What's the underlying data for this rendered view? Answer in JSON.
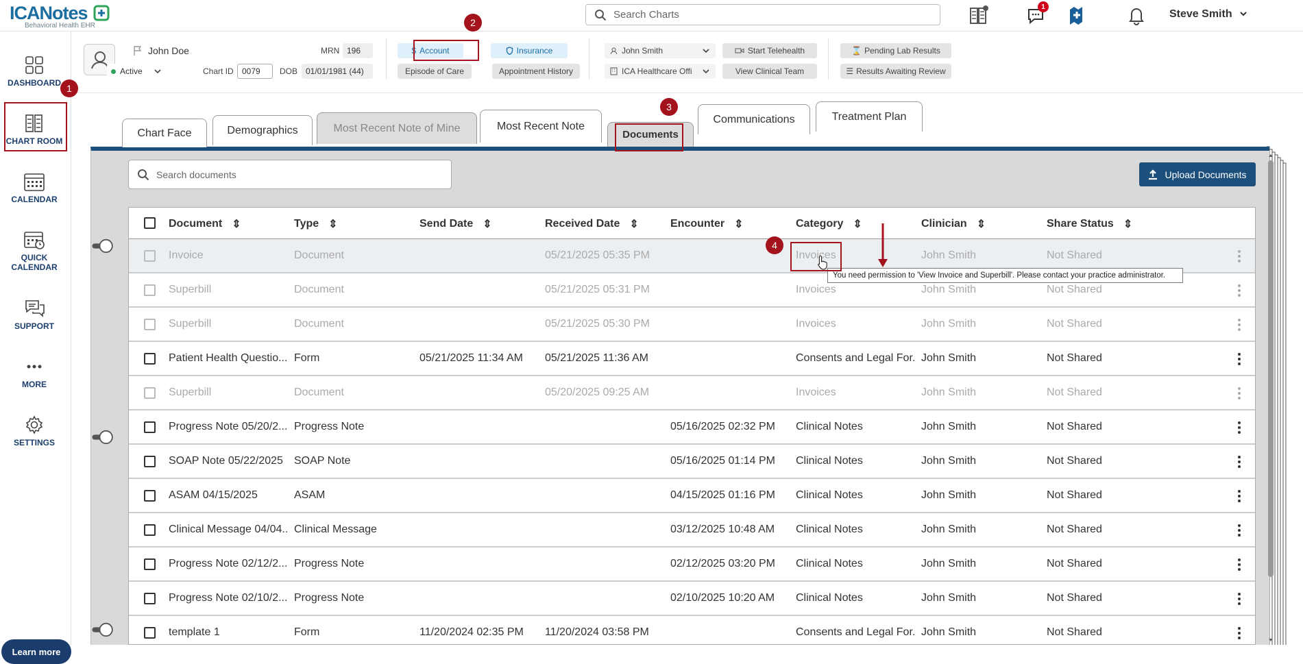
{
  "app": {
    "logo_main": "ICANotes",
    "logo_sub": "Behavioral Health EHR",
    "search_placeholder": "Search Charts",
    "messages_badge": "1",
    "user_name": "Steve Smith"
  },
  "sidebar": {
    "items": [
      {
        "label": "DASHBOARD",
        "icon": "dashboard-icon"
      },
      {
        "label": "CHART ROOM",
        "icon": "chart-room-icon"
      },
      {
        "label": "CALENDAR",
        "icon": "calendar-icon"
      },
      {
        "label": "QUICK CALENDAR",
        "icon": "quick-calendar-icon"
      },
      {
        "label": "SUPPORT",
        "icon": "support-icon"
      },
      {
        "label": "MORE",
        "icon": "more-icon"
      },
      {
        "label": "SETTINGS",
        "icon": "gear-icon"
      }
    ],
    "learn_more": "Learn more"
  },
  "patient": {
    "name": "John Doe",
    "mrn_label": "MRN",
    "mrn": "196",
    "status": "Active",
    "chart_id_label": "Chart ID",
    "chart_id": "0079",
    "dob_label": "DOB",
    "dob": "01/01/1981 (44)"
  },
  "actions": {
    "account": "Account",
    "insurance": "Insurance",
    "episode_of_care": "Episode of Care",
    "appointment_history": "Appointment History",
    "clinician_select": "John Smith",
    "facility_select": "ICA Healthcare Offi",
    "start_telehealth": "Start Telehealth",
    "view_clinical_team": "View Clinical Team",
    "pending_lab_results": "Pending Lab Results",
    "results_awaiting_review": "Results Awaiting Review"
  },
  "tabs": [
    {
      "label": "Chart Face",
      "state": "normal"
    },
    {
      "label": "Demographics",
      "state": "normal"
    },
    {
      "label": "Most Recent Note of Mine",
      "state": "disabled"
    },
    {
      "label": "Most Recent Note",
      "state": "normal"
    },
    {
      "label": "Documents",
      "state": "active"
    },
    {
      "label": "Communications",
      "state": "normal"
    },
    {
      "label": "Treatment Plan",
      "state": "normal"
    }
  ],
  "documents": {
    "search_placeholder": "Search documents",
    "upload_label": "Upload Documents",
    "columns": [
      "Document",
      "Type",
      "Send Date",
      "Received Date",
      "Encounter",
      "Category",
      "Clinician",
      "Share Status"
    ],
    "rows": [
      {
        "document": "Invoice",
        "type": "Document",
        "send_date": "",
        "received_date": "05/21/2025 05:35 PM",
        "encounter": "",
        "category": "Invoices",
        "clinician": "John Smith",
        "share": "Not Shared",
        "dim": true
      },
      {
        "document": "Superbill",
        "type": "Document",
        "send_date": "",
        "received_date": "05/21/2025 05:31 PM",
        "encounter": "",
        "category": "Invoices",
        "clinician": "John Smith",
        "share": "Not Shared",
        "dim": true
      },
      {
        "document": "Superbill",
        "type": "Document",
        "send_date": "",
        "received_date": "05/21/2025 05:30 PM",
        "encounter": "",
        "category": "Invoices",
        "clinician": "John Smith",
        "share": "Not Shared",
        "dim": true
      },
      {
        "document": "Patient Health Questio...",
        "type": "Form",
        "send_date": "05/21/2025 11:34 AM",
        "received_date": "05/21/2025 11:36 AM",
        "encounter": "",
        "category": "Consents and Legal For...",
        "clinician": "John Smith",
        "share": "Not Shared",
        "dim": false
      },
      {
        "document": "Superbill",
        "type": "Document",
        "send_date": "",
        "received_date": "05/20/2025 09:25 AM",
        "encounter": "",
        "category": "Invoices",
        "clinician": "John Smith",
        "share": "Not Shared",
        "dim": true
      },
      {
        "document": "Progress Note 05/20/2...",
        "type": "Progress Note",
        "send_date": "",
        "received_date": "",
        "encounter": "05/16/2025 02:32 PM",
        "category": "Clinical Notes",
        "clinician": "John Smith",
        "share": "Not Shared",
        "dim": false
      },
      {
        "document": "SOAP Note 05/22/2025",
        "type": "SOAP Note",
        "send_date": "",
        "received_date": "",
        "encounter": "05/16/2025 01:14 PM",
        "category": "Clinical Notes",
        "clinician": "John Smith",
        "share": "Not Shared",
        "dim": false
      },
      {
        "document": "ASAM 04/15/2025",
        "type": "ASAM",
        "send_date": "",
        "received_date": "",
        "encounter": "04/15/2025 01:16 PM",
        "category": "Clinical Notes",
        "clinician": "John Smith",
        "share": "Not Shared",
        "dim": false
      },
      {
        "document": "Clinical Message 04/04...",
        "type": "Clinical Message",
        "send_date": "",
        "received_date": "",
        "encounter": "03/12/2025 10:48 AM",
        "category": "Clinical Notes",
        "clinician": "John Smith",
        "share": "Not Shared",
        "dim": false
      },
      {
        "document": "Progress Note 02/12/2...",
        "type": "Progress Note",
        "send_date": "",
        "received_date": "",
        "encounter": "02/12/2025 03:20 PM",
        "category": "Clinical Notes",
        "clinician": "John Smith",
        "share": "Not Shared",
        "dim": false
      },
      {
        "document": "Progress Note 02/10/2...",
        "type": "Progress Note",
        "send_date": "",
        "received_date": "",
        "encounter": "02/10/2025 10:20 AM",
        "category": "Clinical Notes",
        "clinician": "John Smith",
        "share": "Not Shared",
        "dim": false
      },
      {
        "document": "template 1",
        "type": "Form",
        "send_date": "11/20/2024 02:35 PM",
        "received_date": "11/20/2024 03:58 PM",
        "encounter": "",
        "category": "Consents and Legal For...",
        "clinician": "John Smith",
        "share": "Not Shared",
        "dim": false
      }
    ]
  },
  "tooltip": "You need permission to 'View Invoice and Superbill'. Please contact your practice administrator.",
  "steps": [
    "1",
    "2",
    "3",
    "4"
  ],
  "colors": {
    "brand": "#1c4f7c",
    "annotation": "#a4131b",
    "accent_blue": "#1a6fa8"
  }
}
